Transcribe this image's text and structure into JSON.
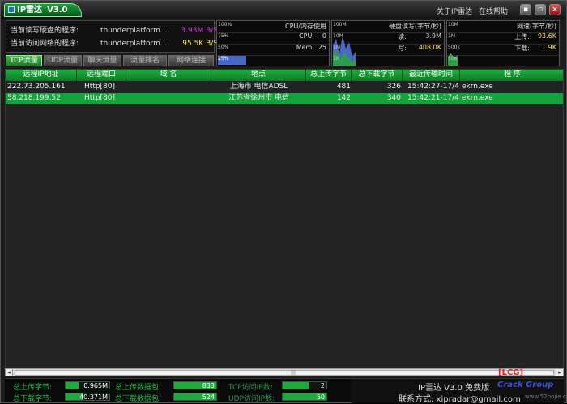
{
  "title": {
    "app_name": "IP雷达",
    "version": "V3.0"
  },
  "menu": {
    "about": "关于IP雷达",
    "help": "在线帮助"
  },
  "window_buttons": {
    "minimize": "▪",
    "maximize": "▫",
    "close": "×"
  },
  "info": {
    "disk_label": "当前读写硬盘的程序:",
    "disk_program": "thunderplatform....",
    "disk_value": "3.93M B/S",
    "net_label": "当前访问网络的程序:",
    "net_program": "thunderplatform....",
    "net_value": "95.5K B/S"
  },
  "cpu_graph": {
    "title": "CPU/内存使用",
    "scale": [
      "100%",
      "75%",
      "50%",
      "25%"
    ],
    "cpu_label": "CPU:",
    "cpu_value": "0",
    "mem_label": "Mem:",
    "mem_value": "25",
    "mem_fill": 0.25
  },
  "disk_graph": {
    "title": "硬盘读写(字节/秒)",
    "scale": [
      "100M",
      "10M",
      "1M",
      "1K"
    ],
    "read_label": "读:",
    "read_value": "3.9M",
    "write_label": "写:",
    "write_value": "408.0K"
  },
  "net_graph": {
    "title": "网速(字节/秒)",
    "scale": [
      "10M",
      "1M",
      "500k",
      "50K"
    ],
    "up_label": "上传:",
    "up_value": "93.6K",
    "down_label": "下载:",
    "down_value": "1.9K"
  },
  "tabs": [
    "TCP流量",
    "UDP流量",
    "聊天流量",
    "流量排名",
    "网络连接"
  ],
  "table": {
    "columns": [
      "远程IP地址",
      "远程端口",
      "域 名",
      "地点",
      "总上传字节",
      "总下载字节",
      "最近传输时间",
      "程 序"
    ],
    "rows": [
      {
        "ip": "222.73.205.161",
        "port": "Http[80]",
        "domain": "",
        "location": "上海市 电信ADSL",
        "up": "481",
        "down": "326",
        "time": "15:42:27-17/4",
        "program": "ekrn.exe"
      },
      {
        "ip": "58.218.199.52",
        "port": "Http[80]",
        "domain": "",
        "location": "江苏省徐州市 电信",
        "up": "142",
        "down": "340",
        "time": "15:42:21-17/4",
        "program": "ekrn.exe"
      }
    ]
  },
  "status": {
    "total_up_label": "总上传字节:",
    "total_up_value": "0.965M",
    "total_down_label": "总下载字节:",
    "total_down_value": "40.371M",
    "up_packets_label": "总上传数据包:",
    "up_packets_value": "833",
    "down_packets_label": "总下载数据包:",
    "down_packets_value": "524",
    "tcp_ip_label": "TCP访问IP数:",
    "tcp_ip_value": "2",
    "udp_ip_label": "UDP访问IP数:",
    "udp_ip_value": "50"
  },
  "brand": {
    "lcg": "[LCG]",
    "app_line": "IP雷达 V3.0 免费版",
    "crack": "Crack Group",
    "contact": "联系方式: xipradar@gmail.com",
    "site": "www.52pojie.cn"
  }
}
